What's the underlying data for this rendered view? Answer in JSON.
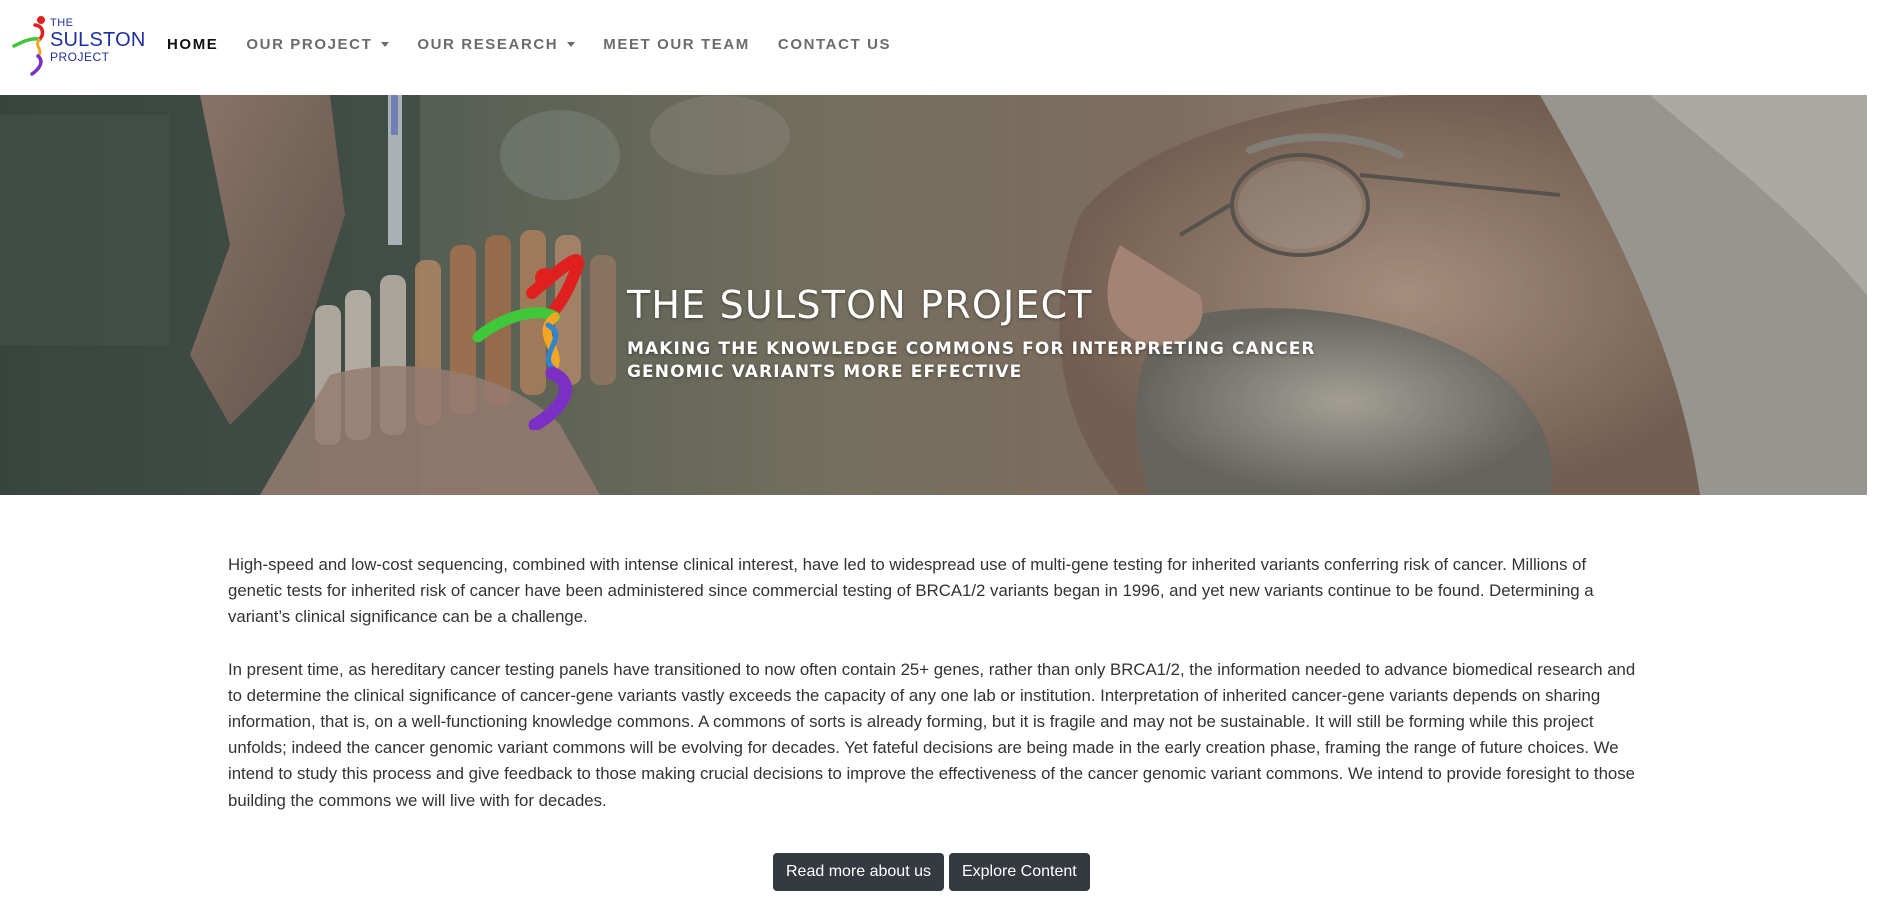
{
  "logo": {
    "line1": "THE",
    "line2": "SULSTON",
    "line3": "PROJECT",
    "text_color": "#1f2fa3"
  },
  "nav": {
    "items": [
      {
        "label": "HOME",
        "active": true
      },
      {
        "label": "OUR PROJECT",
        "dropdown": true
      },
      {
        "label": "OUR RESEARCH",
        "dropdown": true
      },
      {
        "label": "MEET OUR TEAM"
      },
      {
        "label": "CONTACT US"
      }
    ]
  },
  "hero": {
    "title": "THE SULSTON PROJECT",
    "subtitle": "MAKING THE KNOWLEDGE COMMONS FOR INTERPRETING CANCER GENOMIC VARIANTS MORE EFFECTIVE",
    "emblem_colors": [
      "#e0201f",
      "#3fc83a",
      "#f2a623",
      "#7b2fc4"
    ]
  },
  "content": {
    "paragraphs": [
      "High-speed and low-cost sequencing, combined with intense clinical interest, have led to widespread use of multi-gene testing for inherited variants conferring risk of cancer. Millions of genetic tests for inherited risk of cancer have been administered since commercial testing of BRCA1/2 variants began in 1996, and yet new variants continue to be found. Determining a variant’s clinical significance can be a challenge.",
      "In present time, as hereditary cancer testing panels have transitioned to now often contain 25+ genes, rather than only BRCA1/2, the information needed to advance biomedical research and to determine the clinical significance of cancer-gene variants vastly exceeds the capacity of any one lab or institution. Interpretation of inherited cancer-gene variants depends on sharing information, that is, on a well-functioning knowledge commons. A commons of sorts is already forming, but it is fragile and may not be sustainable. It will still be forming while this project unfolds; indeed the cancer genomic variant commons will be evolving for decades. Yet fateful decisions are being made in the early creation phase, framing the range of future choices. We intend to study this process and give feedback to those making crucial decisions to improve the effectiveness of the cancer genomic variant commons. We intend to provide foresight to those building the commons we will live with for decades."
    ]
  },
  "buttons": {
    "read_more": "Read more about us",
    "explore": "Explore Content",
    "color": "#343a40"
  }
}
